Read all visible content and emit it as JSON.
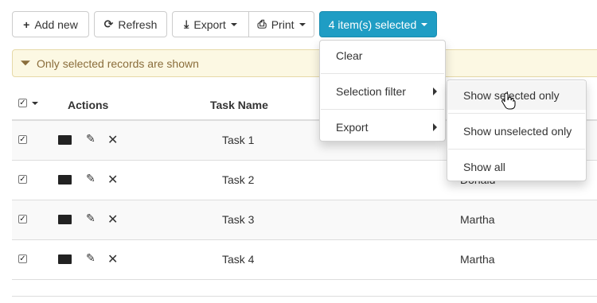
{
  "toolbar": {
    "add_label": "Add new",
    "refresh_label": "Refresh",
    "export_label": "Export",
    "print_label": "Print",
    "selected_label": "4 item(s) selected"
  },
  "alert": {
    "text": "Only selected records are shown"
  },
  "grid": {
    "columns": {
      "actions": "Actions",
      "task_name": "Task Name"
    },
    "rows": [
      {
        "task": "Task 1",
        "assignee": ""
      },
      {
        "task": "Task 2",
        "assignee": "Donald"
      },
      {
        "task": "Task 3",
        "assignee": "Martha"
      },
      {
        "task": "Task 4",
        "assignee": "Martha"
      }
    ]
  },
  "menu": {
    "clear": "Clear",
    "selection_filter": "Selection filter",
    "export": "Export"
  },
  "submenu": {
    "selected_only": "Show selected only",
    "unselected_only": "Show unselected only",
    "all": "Show all"
  },
  "colors": {
    "primary": "#1f9dc4",
    "alert_bg": "#fcf8e3",
    "alert_text": "#8a6d3b"
  }
}
